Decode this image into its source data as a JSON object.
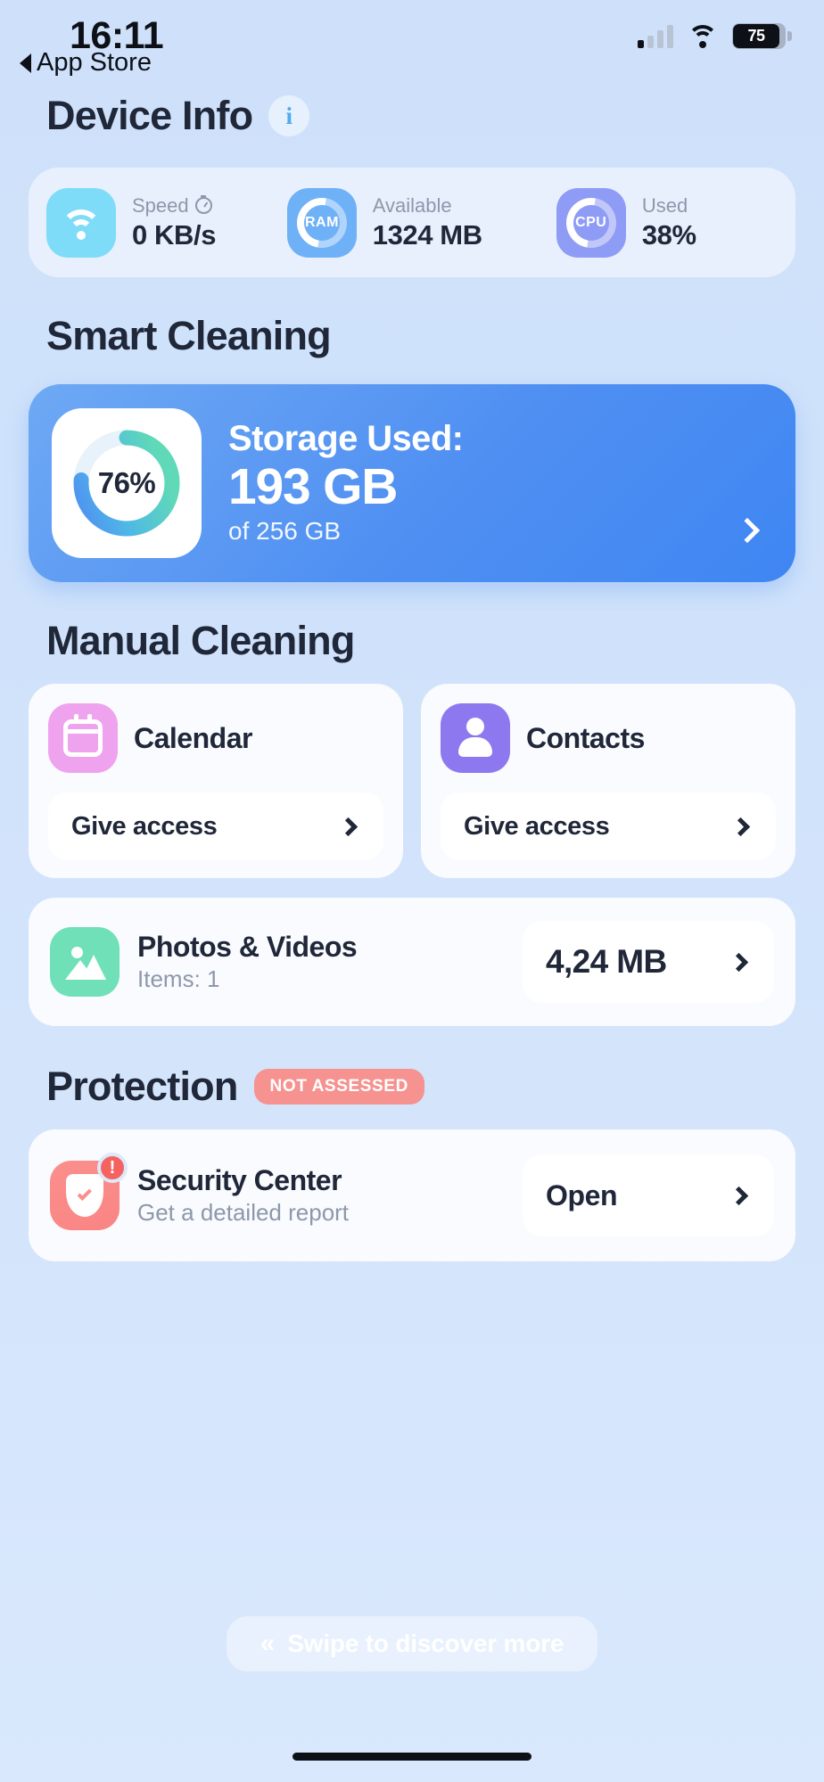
{
  "status_bar": {
    "time": "16:11",
    "back_label": "App Store",
    "battery_level": "75",
    "battery_percent": 75
  },
  "device_info": {
    "heading": "Device Info",
    "info_icon": "info-icon",
    "stats": [
      {
        "icon": "wifi-icon",
        "label": "Speed",
        "label_icon": "stopwatch-icon",
        "value": "0 KB/s"
      },
      {
        "icon": "ram-icon",
        "icon_text": "RAM",
        "label": "Available",
        "value": "1324 MB"
      },
      {
        "icon": "cpu-icon",
        "icon_text": "CPU",
        "label": "Used",
        "value": "38%"
      }
    ]
  },
  "smart_cleaning": {
    "heading": "Smart Cleaning",
    "storage": {
      "percent_label": "76%",
      "percent": 76,
      "title": "Storage Used:",
      "amount": "193 GB",
      "total": "of 256 GB",
      "chevron": "chevron-right-icon"
    }
  },
  "manual_cleaning": {
    "heading": "Manual Cleaning",
    "permission_cards": [
      {
        "icon": "calendar-icon",
        "name": "Calendar",
        "action": "Give access",
        "chevron": "chevron-right-icon"
      },
      {
        "icon": "contacts-icon",
        "name": "Contacts",
        "action": "Give access",
        "chevron": "chevron-right-icon"
      }
    ],
    "media_row": {
      "icon": "photo-icon",
      "title": "Photos & Videos",
      "subtitle": "Items: 1",
      "value": "4,24 MB",
      "chevron": "chevron-right-icon"
    }
  },
  "protection": {
    "heading": "Protection",
    "badge": "NOT ASSESSED",
    "security_row": {
      "icon": "shield-check-icon",
      "alert_icon": "alert-exclamation-icon",
      "alert_symbol": "!",
      "title": "Security Center",
      "subtitle": "Get a detailed report",
      "action": "Open",
      "chevron": "chevron-right-icon"
    }
  },
  "footer": {
    "swipe_hint": "Swipe to discover more",
    "swipe_icon": "double-chevron-left-icon",
    "swipe_glyph": "«"
  },
  "colors": {
    "page_bg": "#d3e4fb",
    "accent_blue": "#4f8ff2",
    "wifi_tile": "#7fdcf8",
    "ram_tile": "#6fb1f7",
    "cpu_tile": "#8e9cf5",
    "calendar_tile": "#efa2ee",
    "contacts_tile": "#8d78f0",
    "photos_tile": "#6fe0b8",
    "security_tile": "#fb8f8c",
    "badge_red": "#f6928f",
    "ring_start": "#4f8ff2",
    "ring_end": "#5fd9b8"
  }
}
